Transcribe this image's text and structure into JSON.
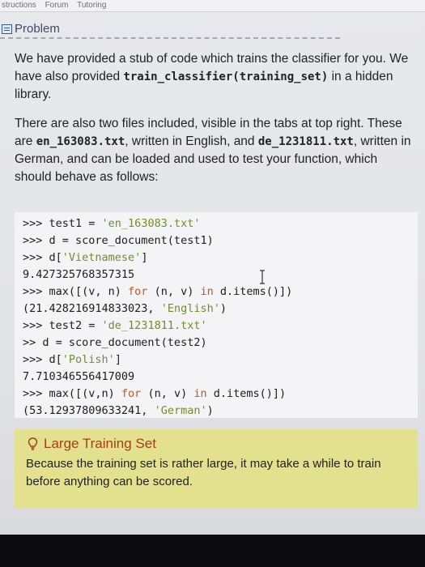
{
  "nav": {
    "items": [
      "structions",
      "Forum",
      "Tutoring"
    ]
  },
  "panel": {
    "title": "Problem",
    "icon": "document-list-icon"
  },
  "body": {
    "p1_before": "We have provided a stub of code which trains the classifier for you. We have also provided ",
    "p1_code": "train_classifier(training_set)",
    "p1_after": " in a hidden library.",
    "p2_a": "There are also two files included, visible in the tabs at top right. These are ",
    "p2_code1": "en_163083.txt",
    "p2_b": ", written in English, and ",
    "p2_code2": "de_1231811.txt",
    "p2_c": ", written in German, and can be loaded and used to test your function, which should behave as follows:"
  },
  "code": {
    "l1_prompt": ">>> test1 = ",
    "l1_str": "'en_163083.txt'",
    "l2": ">>> d = score_document(test1)",
    "l3_prompt": ">>> d[",
    "l3_str": "'Vietnamese'",
    "l3_end": "]",
    "l4": "9.427325768357315",
    "l5_a": ">>> max([(v, n) ",
    "l5_for": "for",
    "l5_b": " (n, v) ",
    "l5_in": "in",
    "l5_c": " d.items()])",
    "l6_a": "(21.428216914833023, ",
    "l6_str": "'English'",
    "l6_b": ")",
    "l7_prompt": ">>> test2 = ",
    "l7_str": "'de_1231811.txt'",
    "l8": ">> d = score_document(test2)",
    "l9_prompt": ">>> d[",
    "l9_str": "'Polish'",
    "l9_end": "]",
    "l10": "7.710346556417009",
    "l11_a": ">>> max([(v,n) ",
    "l11_for": "for",
    "l11_b": " (n, v) ",
    "l11_in": "in",
    "l11_c": " d.items()])",
    "l12_a": "(53.12937809633241, ",
    "l12_str": "'German'",
    "l12_b": ")"
  },
  "note": {
    "icon": "lightbulb-icon",
    "title": "Large Training Set",
    "text": "Because the training set is rather large, it may take a while to train before anything can be scored."
  },
  "colors": {
    "note_bg": "#e3e08e",
    "note_title": "#a23f1c",
    "string": "#6f8f2a",
    "keyword": "#c2571a"
  }
}
